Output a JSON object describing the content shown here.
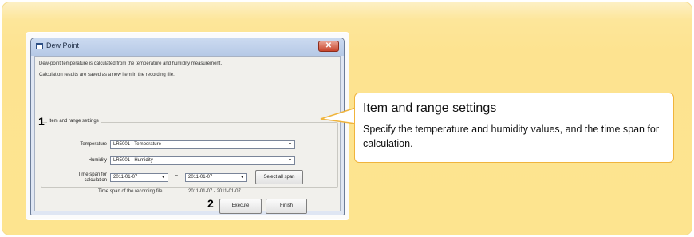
{
  "dialog": {
    "title": "Dew Point",
    "close_label": "✕",
    "description_line1": "Dew-point temperature is calculated from the temperature and humidity measurement.",
    "description_line2": "Calculation results are saved as a new item in the recording file.",
    "group_title": "Item and range settings",
    "step1": "1",
    "step2": "2",
    "temperature_label": "Temperature",
    "temperature_value": "LR5001 - Temperature",
    "humidity_label": "Humidity",
    "humidity_value": "LR5001 - Humidity",
    "timespan_label_line1": "Time span for",
    "timespan_label_line2": "calculation",
    "start_date": "2011-01-07",
    "range_separator": "~",
    "end_date": "2011-01-07",
    "select_all_span": "Select all span",
    "recording_span_label": "Time span of the recording file",
    "recording_span_value": "2011-01-07 - 2011-01-07",
    "execute_label": "Execute",
    "finish_label": "Finish"
  },
  "callout": {
    "title": "Item and range settings",
    "body": "Specify the temperature and humidity values, and the time span for calculation."
  },
  "colors": {
    "panel": "#fde48f",
    "callout_border": "#f0b43c",
    "close_button": "#c8452c"
  },
  "icons": {
    "window": "window-icon",
    "close": "close-icon",
    "dropdown": "chevron-down-icon"
  }
}
